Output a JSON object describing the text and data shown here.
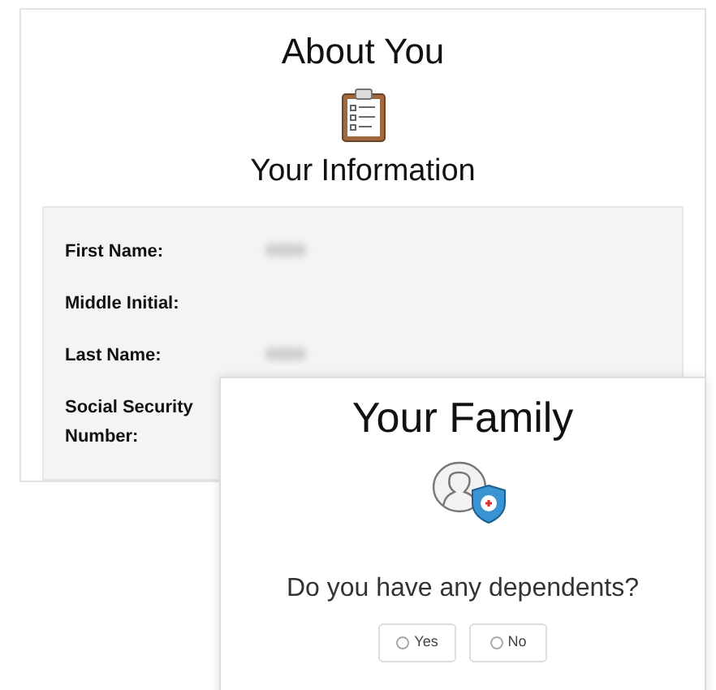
{
  "about": {
    "title": "About You",
    "subtitle": "Your Information",
    "fields": [
      {
        "label": "First Name:",
        "redacted": true
      },
      {
        "label": "Middle Initial:",
        "redacted": false
      },
      {
        "label": "Last Name:",
        "redacted": true
      },
      {
        "label": "Social Security Number:",
        "redacted": false
      }
    ]
  },
  "family": {
    "title": "Your Family",
    "question": "Do you have any dependents?",
    "options": [
      {
        "label": "Yes",
        "selected": false
      },
      {
        "label": "No",
        "selected": false
      }
    ]
  }
}
